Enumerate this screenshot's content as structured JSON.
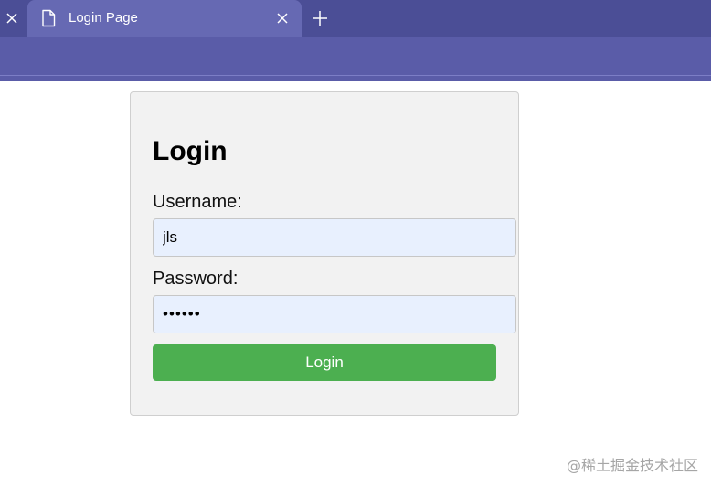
{
  "browser": {
    "tab_title": "Login Page"
  },
  "icons": {
    "prev_tab_close": "close-icon",
    "tab_page": "document-icon",
    "tab_close": "close-icon",
    "new_tab": "plus-icon"
  },
  "colors": {
    "tabbar": "#4b4e96",
    "active_tab": "#6669b3",
    "toolbar": "#5a5ca8",
    "card_background": "#f2f2f2",
    "input_background": "#e8f0fe",
    "button": "#4caf50"
  },
  "login": {
    "title": "Login",
    "username_label": "Username:",
    "username_value": "jls",
    "password_label": "Password:",
    "password_value": "123456",
    "button_label": "Login"
  },
  "watermark": "@稀土掘金技术社区"
}
